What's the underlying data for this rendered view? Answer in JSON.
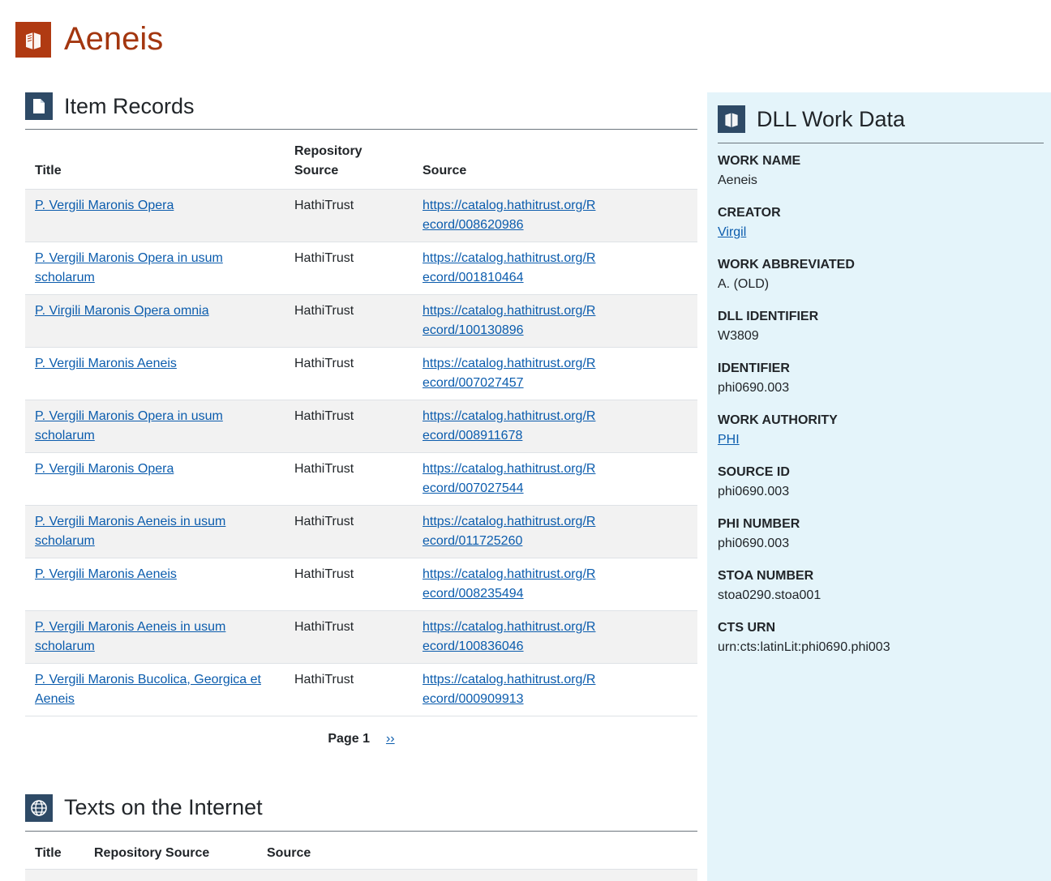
{
  "page": {
    "title": "Aeneis",
    "accent_color": "#b03a12",
    "icon": "book-icon"
  },
  "item_records": {
    "heading": "Item Records",
    "icon": "document-icon",
    "columns": [
      "Title",
      "Repository Source",
      "Source"
    ],
    "rows": [
      {
        "title": "P. Vergili Maronis Opera",
        "repo": "HathiTrust",
        "source": "https://catalog.hathitrust.org/Record/008620986"
      },
      {
        "title": "P. Vergili Maronis Opera in usum scholarum",
        "repo": "HathiTrust",
        "source": "https://catalog.hathitrust.org/Record/001810464"
      },
      {
        "title": "P. Virgili Maronis Opera omnia",
        "repo": "HathiTrust",
        "source": "https://catalog.hathitrust.org/Record/100130896"
      },
      {
        "title": "P. Vergili Maronis Aeneis",
        "repo": "HathiTrust",
        "source": "https://catalog.hathitrust.org/Record/007027457"
      },
      {
        "title": "P. Vergili Maronis Opera in usum scholarum",
        "repo": "HathiTrust",
        "source": "https://catalog.hathitrust.org/Record/008911678"
      },
      {
        "title": "P. Vergili Maronis Opera",
        "repo": "HathiTrust",
        "source": "https://catalog.hathitrust.org/Record/007027544"
      },
      {
        "title": "P. Vergili Maronis Aeneis in usum scholarum",
        "repo": "HathiTrust",
        "source": "https://catalog.hathitrust.org/Record/011725260"
      },
      {
        "title": "P. Vergili Maronis Aeneis",
        "repo": "HathiTrust",
        "source": "https://catalog.hathitrust.org/Record/008235494"
      },
      {
        "title": "P. Vergili Maronis Aeneis in usum scholarum",
        "repo": "HathiTrust",
        "source": "https://catalog.hathitrust.org/Record/100836046"
      },
      {
        "title": "P. Vergili Maronis Bucolica, Georgica et Aeneis",
        "repo": "HathiTrust",
        "source": "https://catalog.hathitrust.org/Record/000909913"
      }
    ],
    "pager": {
      "current": "Page 1",
      "next": "››"
    }
  },
  "texts": {
    "heading": "Texts on the Internet",
    "icon": "globe-icon",
    "columns": [
      "Title",
      "Repository Source",
      "Source"
    ]
  },
  "sidebar": {
    "heading": "DLL Work Data",
    "icon": "book-icon",
    "background": "#e4f4fa",
    "fields": [
      {
        "label": "Work Name",
        "value": "Aeneis",
        "link": false
      },
      {
        "label": "Creator",
        "value": "Virgil",
        "link": true
      },
      {
        "label": "Work Abbreviated",
        "value": "A. (OLD)",
        "link": false
      },
      {
        "label": "DLL Identifier",
        "value": "W3809",
        "link": false
      },
      {
        "label": "Identifier",
        "value": "phi0690.003",
        "link": false
      },
      {
        "label": "Work Authority",
        "value": "PHI",
        "link": true
      },
      {
        "label": "Source ID",
        "value": "phi0690.003",
        "link": false
      },
      {
        "label": "PHI Number",
        "value": "phi0690.003",
        "link": false
      },
      {
        "label": "STOA Number",
        "value": "stoa0290.stoa001",
        "link": false
      },
      {
        "label": "CTS URN",
        "value": "urn:cts:latinLit:phi0690.phi003",
        "link": false
      }
    ]
  }
}
